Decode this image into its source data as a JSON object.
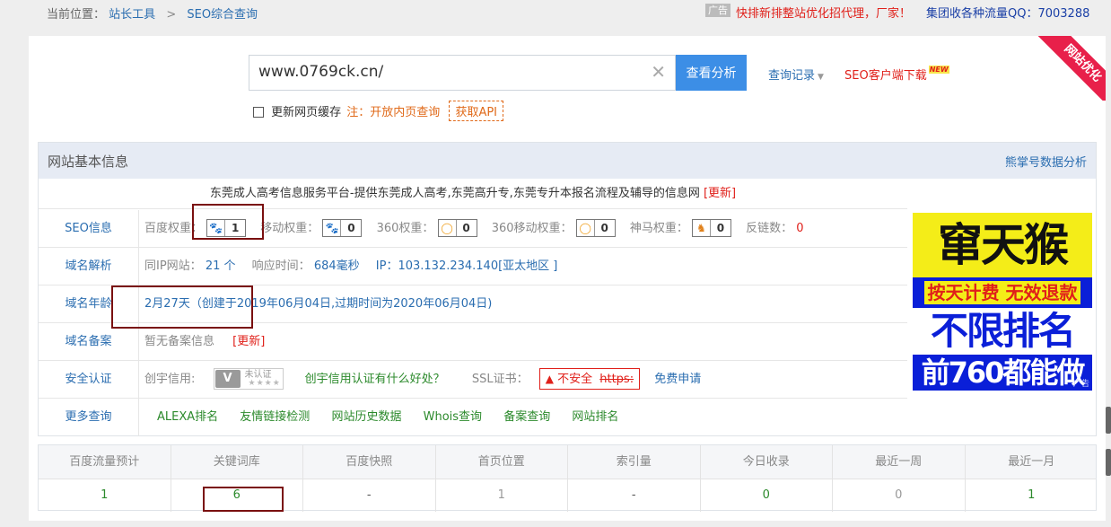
{
  "breadcrumb": {
    "prefix": "当前位置：",
    "home": "站长工具",
    "sep": ">",
    "current": "SEO综合查询"
  },
  "ads_top": {
    "tag": "广告",
    "text": "快排新排整站优化招代理，厂家！",
    "qq": "集团收各种流量QQ：7003288"
  },
  "ribbon": "网站优化",
  "search": {
    "value": "www.0769ck.cn/",
    "button": "查看分析",
    "history": "查询记录",
    "client": "SEO客户端下载",
    "new_badge": "NEW"
  },
  "options": {
    "refresh": "更新网页缓存",
    "note": "注：开放内页查询",
    "api": "获取API"
  },
  "info": {
    "title": "网站基本信息",
    "right_link": "熊掌号数据分析",
    "site_title": "东莞成人高考信息服务平台-提供东莞成人高考,东莞高升专,东莞专升本报名流程及辅导的信息网",
    "update": "[更新]"
  },
  "seo": {
    "label": "SEO信息",
    "baidu_label": "百度权重：",
    "baidu_val": "1",
    "mobile_label": "移动权重：",
    "mobile_val": "0",
    "s360_label": "360权重：",
    "s360_val": "0",
    "s360m_label": "360移动权重：",
    "s360m_val": "0",
    "shenma_label": "神马权重：",
    "shenma_val": "0",
    "backlink_label": "反链数：",
    "backlink_val": "0"
  },
  "dns": {
    "label": "域名解析",
    "ip_label": "同IP网站：",
    "ip_count": "21 个",
    "resp_label": "响应时间：",
    "resp_val": "684毫秒",
    "ip_val": "IP：103.132.234.140[亚太地区 ]"
  },
  "age": {
    "label": "域名年龄",
    "val": "2月27天（创建于2019年06月04日,过期时间为2020年06月04日)"
  },
  "icp": {
    "label": "域名备案",
    "val": "暂无备案信息",
    "update": "[更新]"
  },
  "security": {
    "label": "安全认证",
    "cx_label": "创宇信用:",
    "cx_v": "V",
    "cx_status": "未认证",
    "cx_dots": "★★★★",
    "cx_link": "创宇信用认证有什么好处？",
    "ssl_label": "SSL证书：",
    "ssl_status": "不安全",
    "ssl_https": "https:",
    "ssl_apply": "免费申请"
  },
  "more": {
    "label": "更多查询",
    "links": [
      "ALEXA排名",
      "友情链接检测",
      "网站历史数据",
      "Whois查询",
      "备案查询",
      "网站排名"
    ]
  },
  "side_ad": {
    "line1": "窜天猴",
    "line2": "按天计费 无效退款",
    "line3": "不限排名",
    "line4": "前760都能做",
    "mini": "广告"
  },
  "stats": {
    "headers": [
      "百度流量预计",
      "关键词库",
      "百度快照",
      "首页位置",
      "索引量",
      "今日收录",
      "最近一周",
      "最近一月"
    ],
    "values": [
      "1",
      "6",
      "-",
      "1",
      "-",
      "0",
      "0",
      "1"
    ]
  },
  "colors": {
    "accent_blue": "#3c8ee6",
    "link_blue": "#2a6db0",
    "alert_red": "#e0201a",
    "link_green": "#2c8a2c",
    "highlight_border": "#7a1010"
  }
}
